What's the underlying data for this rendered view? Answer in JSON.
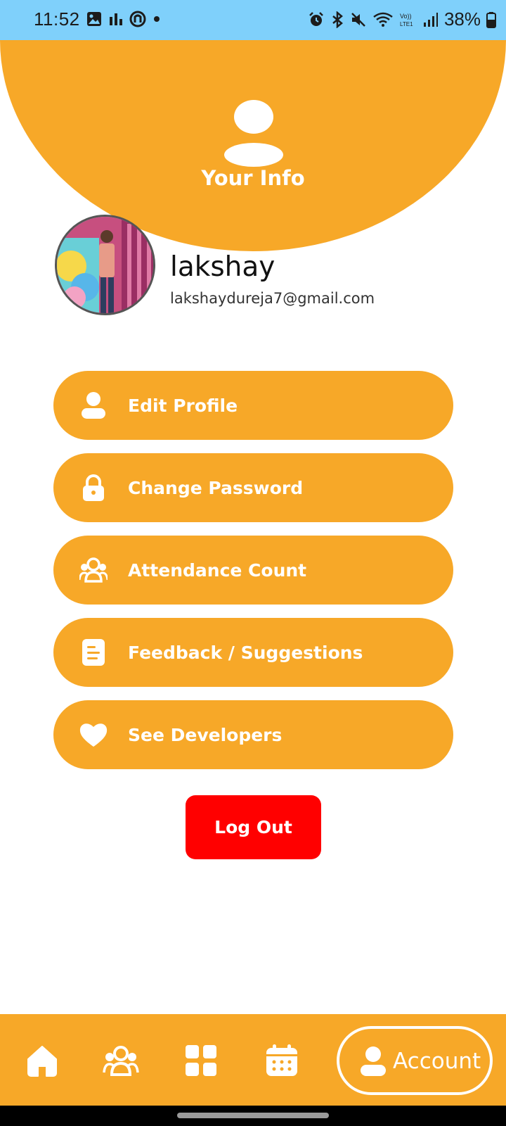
{
  "status_bar": {
    "time": "11:52",
    "battery": "38%",
    "left_icons": [
      "gallery-icon",
      "chart-icon",
      "app-icon",
      "dot-icon"
    ],
    "right_icons": [
      "alarm-icon",
      "bluetooth-icon",
      "mute-icon",
      "wifi-icon",
      "volte-icon",
      "signal-icon",
      "battery-icon"
    ]
  },
  "header": {
    "title": "Your Info"
  },
  "profile": {
    "name": "lakshay",
    "email": "lakshaydureja7@gmail.com"
  },
  "menu": {
    "items": [
      {
        "label": "Edit Profile",
        "icon": "user-icon"
      },
      {
        "label": "Change Password",
        "icon": "lock-icon"
      },
      {
        "label": "Attendance Count",
        "icon": "users-icon"
      },
      {
        "label": "Feedback / Suggestions",
        "icon": "document-icon"
      },
      {
        "label": "See Developers",
        "icon": "heart-icon"
      }
    ]
  },
  "logout": {
    "label": "Log Out"
  },
  "bottom_nav": {
    "items": [
      "home-icon",
      "group-icon",
      "grid-icon",
      "calendar-icon"
    ],
    "active": {
      "label": "Account",
      "icon": "user-icon"
    }
  },
  "colors": {
    "accent": "#f7a828",
    "status_bar": "#7fd0fb",
    "logout": "#ff0000"
  }
}
